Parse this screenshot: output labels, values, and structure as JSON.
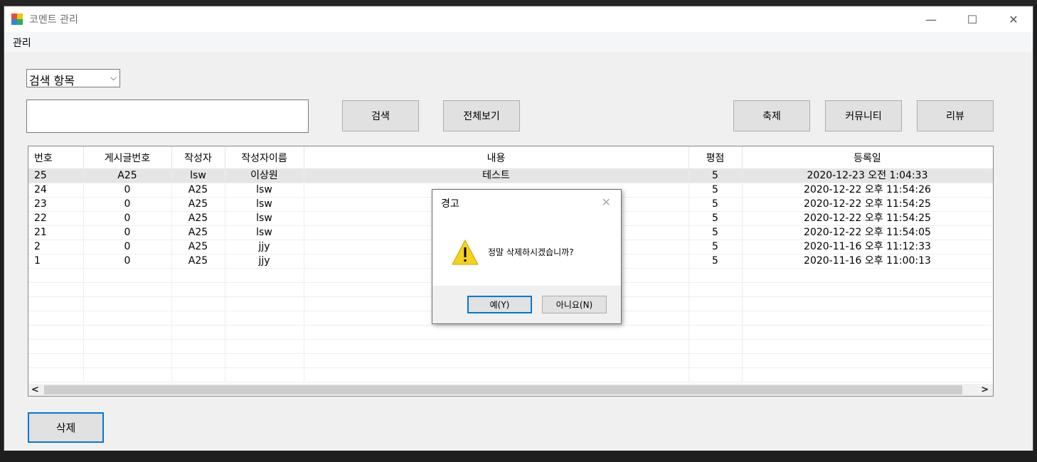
{
  "window": {
    "title": "코멘트 관리",
    "minimize_glyph": "—",
    "maximize_glyph": "☐",
    "close_glyph": "✕",
    "icon": "app-window-icon"
  },
  "menu": {
    "items": [
      "관리"
    ]
  },
  "search": {
    "combo_value": "검색 항목",
    "combo_arrow": "⌵",
    "input_value": "",
    "search_button": "검색",
    "show_all_button": "전체보기"
  },
  "filters": {
    "festival_button": "축제",
    "community_button": "커뮤니티",
    "review_button": "리뷰"
  },
  "grid": {
    "columns": [
      "번호",
      "게시글번호",
      "작성자",
      "작성자이름",
      "내용",
      "평점",
      "등록일"
    ],
    "rows": [
      [
        "25",
        "A25",
        "lsw",
        "이상원",
        "테스트",
        "5",
        "2020-12-23 오전 1:04:33"
      ],
      [
        "24",
        "0",
        "A25",
        "lsw",
        "",
        "5",
        "2020-12-22 오후 11:54:26"
      ],
      [
        "23",
        "0",
        "A25",
        "lsw",
        "",
        "5",
        "2020-12-22 오후 11:54:25"
      ],
      [
        "22",
        "0",
        "A25",
        "lsw",
        "",
        "5",
        "2020-12-22 오후 11:54:25"
      ],
      [
        "21",
        "0",
        "A25",
        "lsw",
        "",
        "5",
        "2020-12-22 오후 11:54:05"
      ],
      [
        "2",
        "0",
        "A25",
        "jjy",
        "",
        "5",
        "2020-11-16 오후 11:12:33"
      ],
      [
        "1",
        "0",
        "A25",
        "jjy",
        "",
        "5",
        "2020-11-16 오후 11:00:13"
      ]
    ],
    "selected_row": 0,
    "scroll_left": "<",
    "scroll_right": ">"
  },
  "delete_button": "삭제",
  "dialog": {
    "title": "경고",
    "close_glyph": "✕",
    "message": "정말 삭제하시겠습니까?",
    "icon": "warning-icon",
    "yes_button": "예(Y)",
    "no_button": "아니요(N)"
  },
  "colors": {
    "window_bg": "#f0f0f0",
    "button_bg": "#e1e1e1",
    "focus_border": "#0078d7",
    "selected_row": "#e5e5e5",
    "warning_yellow": "#f7d11e"
  }
}
